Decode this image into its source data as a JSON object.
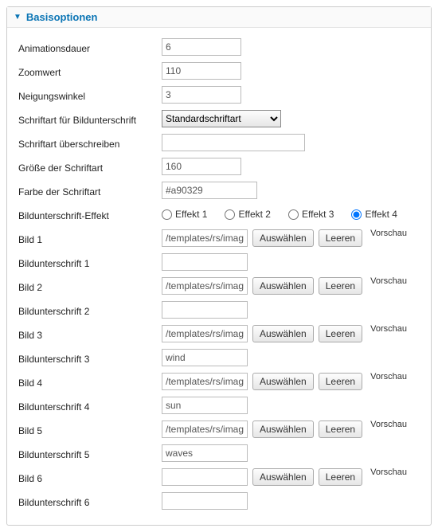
{
  "panel": {
    "title": "Basisoptionen"
  },
  "labels": {
    "animationsdauer": "Animationsdauer",
    "zoomwert": "Zoomwert",
    "neigungswinkel": "Neigungswinkel",
    "schriftart_bildunterschrift": "Schriftart für Bildunterschrift",
    "schriftart_ueberschreiben": "Schriftart überschreiben",
    "groesse_schriftart": "Größe der Schriftart",
    "farbe_schriftart": "Farbe der Schriftart",
    "bildunterschrift_effekt": "Bildunterschrift-Effekt",
    "bild1": "Bild 1",
    "bildunterschrift1": "Bildunterschrift 1",
    "bild2": "Bild 2",
    "bildunterschrift2": "Bildunterschrift 2",
    "bild3": "Bild 3",
    "bildunterschrift3": "Bildunterschrift 3",
    "bild4": "Bild 4",
    "bildunterschrift4": "Bildunterschrift 4",
    "bild5": "Bild 5",
    "bildunterschrift5": "Bildunterschrift 5",
    "bild6": "Bild 6",
    "bildunterschrift6": "Bildunterschrift 6"
  },
  "values": {
    "animationsdauer": "6",
    "zoomwert": "110",
    "neigungswinkel": "3",
    "schriftart_select": "Standardschriftart",
    "schriftart_ueberschreiben": "",
    "groesse_schriftart": "160",
    "farbe_schriftart": "#a90329",
    "bild1": "/templates/rs/images",
    "bildunterschrift1": "",
    "bild2": "/templates/rs/images",
    "bildunterschrift2": "",
    "bild3": "/templates/rs/images",
    "bildunterschrift3": "wind",
    "bild4": "/templates/rs/images",
    "bildunterschrift4": "sun",
    "bild5": "/templates/rs/images",
    "bildunterschrift5": "waves",
    "bild6": "",
    "bildunterschrift6": ""
  },
  "effects": {
    "opt1": "Effekt 1",
    "opt2": "Effekt 2",
    "opt3": "Effekt 3",
    "opt4": "Effekt 4",
    "selected": "opt4"
  },
  "buttons": {
    "auswaehlen": "Auswählen",
    "leeren": "Leeren",
    "vorschau": "Vorschau"
  }
}
